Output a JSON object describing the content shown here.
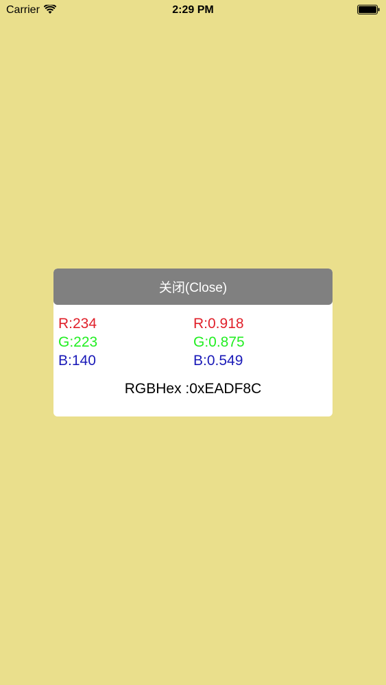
{
  "status_bar": {
    "carrier": "Carrier",
    "time": "2:29 PM",
    "icons": [
      "wifi-icon",
      "battery-icon"
    ]
  },
  "colors": {
    "background": "#EADF8C",
    "dialog_background": "#FFFFFF",
    "close_button_background": "#808080",
    "close_button_text": "#FFFFFF",
    "red_label": "#E0202A",
    "green_label": "#22EE22",
    "blue_label": "#1A1AB8"
  },
  "dialog": {
    "close_label": "关闭(Close)",
    "integer": {
      "r": "R:234",
      "g": "G:223",
      "b": "B:140"
    },
    "fraction": {
      "r": "R:0.918",
      "g": "G:0.875",
      "b": "B:0.549"
    },
    "hex": "RGBHex :0xEADF8C"
  }
}
